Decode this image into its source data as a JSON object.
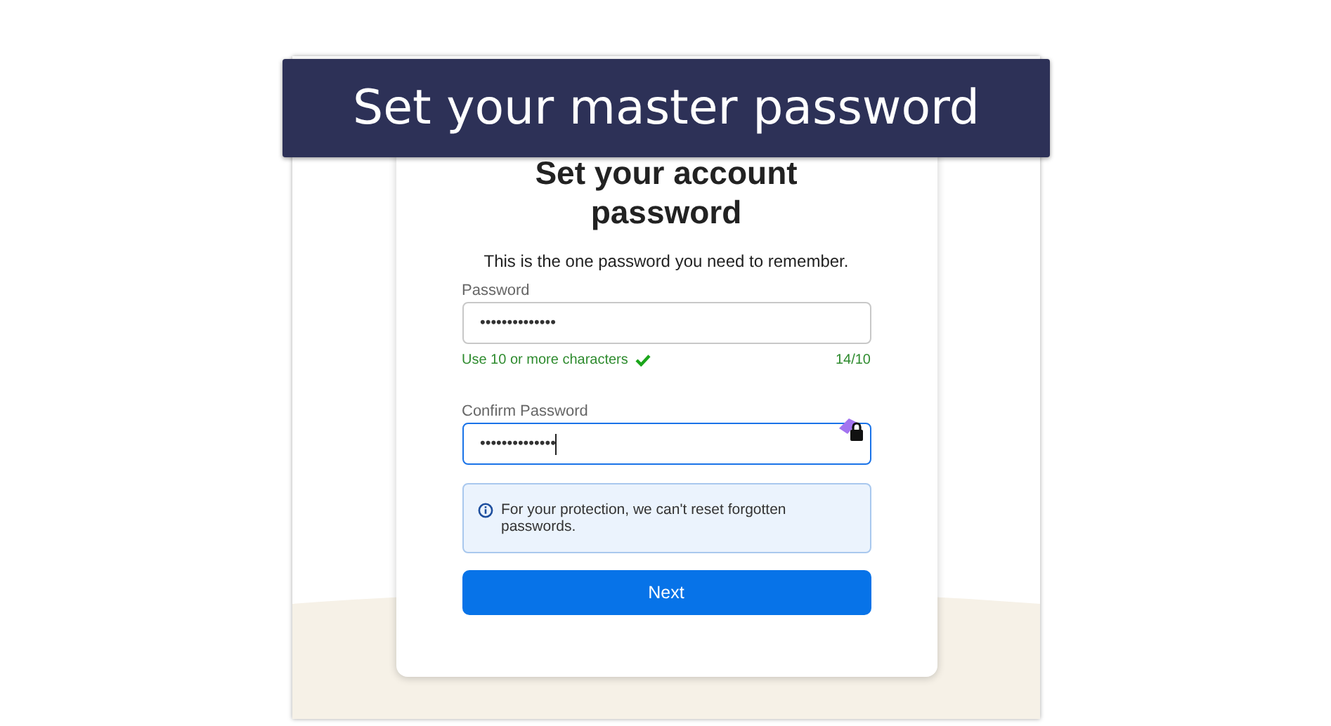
{
  "banner": {
    "title": "Set your master password"
  },
  "card": {
    "heading": "Set your account password",
    "subtitle": "This is the one password you need to remember.",
    "fields": [
      {
        "label": "Password",
        "value": "••••••••••••••",
        "focused": false
      },
      {
        "label": "Confirm Password",
        "value": "••••••••••••••",
        "focused": true
      }
    ],
    "requirement": {
      "text": "Use 10 or more characters",
      "met": true,
      "count": "14/10"
    },
    "notice": "For your protection, we can't reset forgotten passwords.",
    "button": "Next"
  }
}
